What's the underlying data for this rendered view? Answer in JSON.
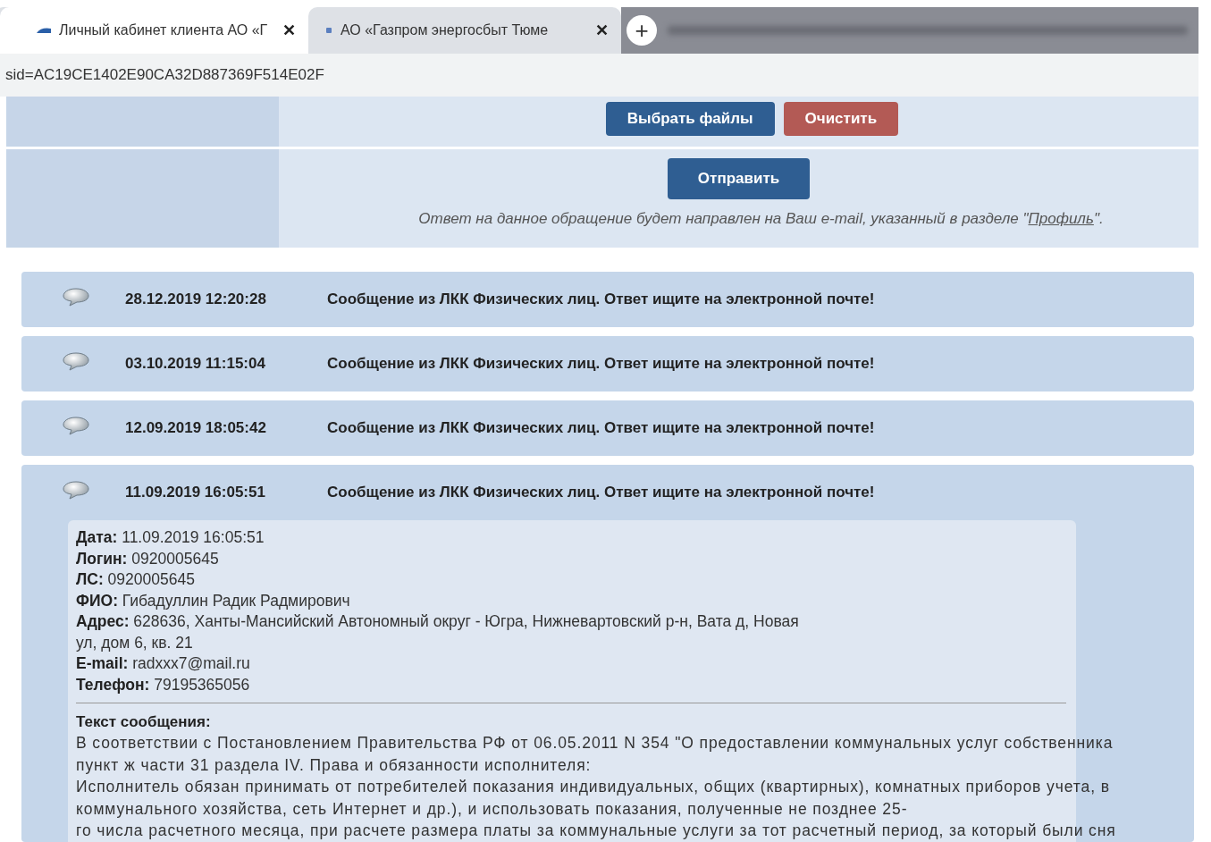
{
  "browser": {
    "tabs": [
      {
        "title": "Личный кабинет клиента АО «Г",
        "selected": true,
        "close": "✕"
      },
      {
        "title": "АО «Газпром энергосбыт Тюме",
        "selected": false,
        "close": "✕"
      }
    ],
    "new_tab": "+",
    "address": "sid=AC19CE1402E90CA32D887369F514E02F"
  },
  "form": {
    "file_buttons": [
      {
        "label": "Выбрать файлы",
        "kind": "primary"
      },
      {
        "label": "Очистить",
        "kind": "danger"
      }
    ],
    "submit": "Отправить",
    "note": {
      "before": "Ответ на данное обращение будет направлен на Ваш e-mail, указанный в разделе \"",
      "link": "Профиль",
      "after": "\"."
    }
  },
  "messages": [
    {
      "date": "28.12.2019 12:20:28",
      "subject": "Сообщение из ЛКК Физических лиц. Ответ ищите на электронной почте!"
    },
    {
      "date": "03.10.2019 11:15:04",
      "subject": "Сообщение из ЛКК Физических лиц. Ответ ищите на электронной почте!"
    },
    {
      "date": "12.09.2019 18:05:42",
      "subject": "Сообщение из ЛКК Физических лиц. Ответ ищите на электронной почте!"
    },
    {
      "date": "11.09.2019 16:05:51",
      "subject": "Сообщение из ЛКК Физических лиц. Ответ ищите на электронной почте!",
      "details": {
        "fields": [
          "**Дата:** 11.09.2019  16:05:51",
          "**Логин:** 0920005645",
          "**ЛС:** 0920005645",
          "**ФИО:** Гибадуллин Радик Радмирович",
          "**Адрес:** 628636, Ханты-Мансийский Автономный округ - Югра, Нижневартовский р-н, Вата д, Новая ул, дом 6, кв. 21",
          "**E-mail:** radxxx7@mail.ru",
          "**Телефон:** 79195365056"
        ],
        "text_title": "Текст сообщения:",
        "text_lines": [
          "В соответствии с Постановлением Правительства РФ от 06.05.2011 N 354 \"О предоставлении коммунальных услуг собственника",
          "пункт ж части 31 раздела IV. Права и обязанности исполнителя:",
          "Исполнитель обязан принимать от потребителей показания индивидуальных, общих (квартирных), комнатных приборов учета, в",
          "коммунального хозяйства, сеть Интернет и др.), и использовать показания, полученные не позднее 25-",
          "го числа расчетного месяца, при расчете размера платы за коммунальные услуги за тот расчетный период, за который были сня"
        ]
      }
    }
  ]
}
